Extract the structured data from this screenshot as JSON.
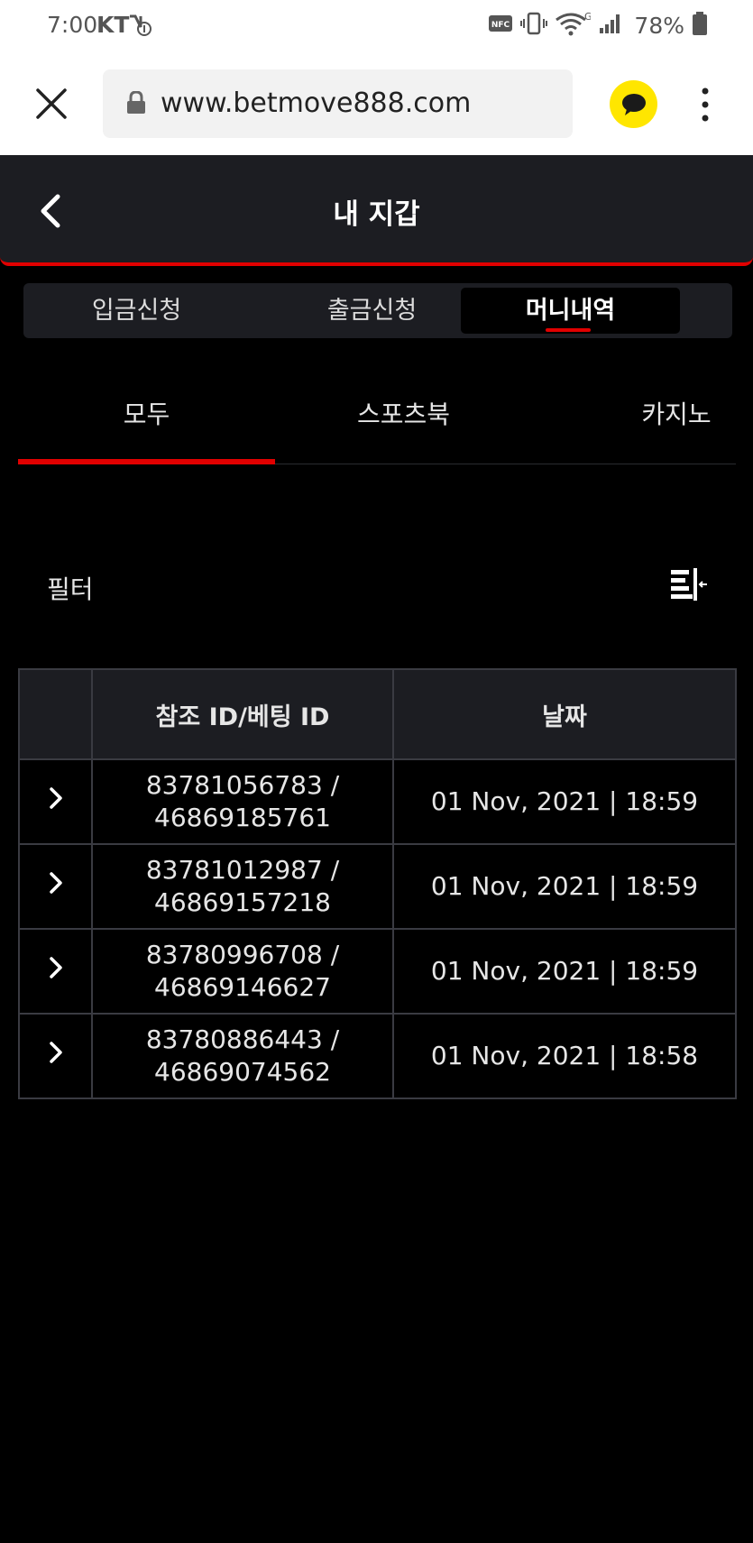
{
  "status_bar": {
    "time": "7:00",
    "carrier": "KT",
    "battery": "78%",
    "icons": [
      "nfc-icon",
      "vibrate-icon",
      "wifi-icon",
      "signal-icon",
      "battery-icon"
    ]
  },
  "browser": {
    "url": "www.betmove888.com",
    "icons": [
      "close-icon",
      "lock-icon",
      "kakao-talk-icon",
      "more-vert-icon"
    ],
    "kakao_color": "#ffe600"
  },
  "header": {
    "title": "내 지갑",
    "accent_color": "#e10000"
  },
  "top_tabs": [
    {
      "label": "입금신청",
      "active": false
    },
    {
      "label": "출금신청",
      "active": false
    },
    {
      "label": "머니내역",
      "active": true
    }
  ],
  "sub_tabs": [
    {
      "label": "모두",
      "active": true
    },
    {
      "label": "스포츠북",
      "active": false
    },
    {
      "label": "카지노",
      "active": false
    }
  ],
  "filter": {
    "label": "필터",
    "icon": "filter-list-icon"
  },
  "table": {
    "columns": [
      "",
      "참조 ID/베팅 ID",
      "날짜"
    ],
    "rows": [
      {
        "ref_id": "83781056783 /",
        "bet_id": "46869185761",
        "date": "01 Nov, 2021 | 18:59"
      },
      {
        "ref_id": "83781012987 /",
        "bet_id": "46869157218",
        "date": "01 Nov, 2021 | 18:59"
      },
      {
        "ref_id": "83780996708 /",
        "bet_id": "46869146627",
        "date": "01 Nov, 2021 | 18:59"
      },
      {
        "ref_id": "83780886443 /",
        "bet_id": "46869074562",
        "date": "01 Nov, 2021 | 18:58"
      }
    ]
  }
}
